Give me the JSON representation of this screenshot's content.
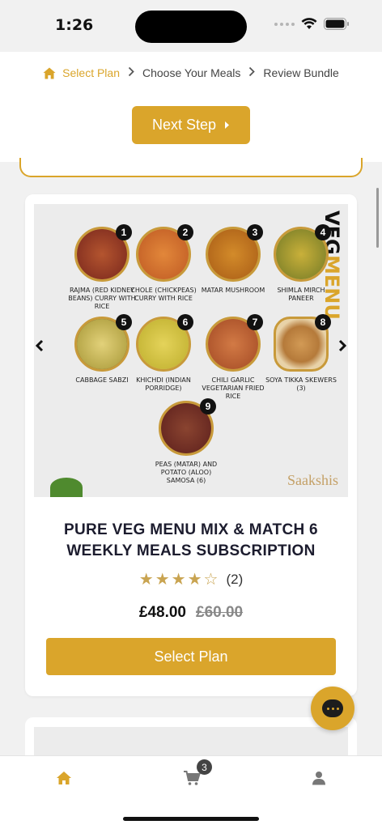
{
  "status": {
    "time": "1:26"
  },
  "breadcrumb": {
    "steps": [
      {
        "label": "Select Plan",
        "icon": "home-icon",
        "active": true
      },
      {
        "label": "Choose Your Meals",
        "active": false
      },
      {
        "label": "Review Bundle",
        "active": false
      }
    ]
  },
  "header": {
    "next_step_label": "Next Step"
  },
  "menu_image": {
    "title_line1": "VEG",
    "title_line2": "MENU",
    "brand": "Saakshis",
    "dishes": [
      {
        "num": "1",
        "name": "RAJMA (RED KIDNEY BEANS) CURRY WITH RICE",
        "color": "#a8452d"
      },
      {
        "num": "2",
        "name": "CHOLE (CHICKPEAS) CURRY WITH RICE",
        "color": "#d77a2c"
      },
      {
        "num": "3",
        "name": "MATAR MUSHROOM",
        "color": "#c2761f"
      },
      {
        "num": "4",
        "name": "SHIMLA MIRCH PANEER",
        "color": "#c8a52e"
      },
      {
        "num": "5",
        "name": "CABBAGE SABZI",
        "color": "#d9c06a"
      },
      {
        "num": "6",
        "name": "KHICHDI (INDIAN PORRIDGE)",
        "color": "#d8c84a"
      },
      {
        "num": "7",
        "name": "CHILI GARLIC VEGETARIAN FRIED RICE",
        "color": "#c46a3a"
      },
      {
        "num": "8",
        "name": "SOYA TIKKA SKEWERS (3)",
        "color": "#c98f4a"
      },
      {
        "num": "9",
        "name": "PEAS (MATAR) AND POTATO (ALOO) SAMOSA (6)",
        "color": "#7a3a2a"
      }
    ]
  },
  "product": {
    "name": "PURE VEG MENU MIX & MATCH 6 WEEKLY MEALS SUBSCRIPTION",
    "rating": 4,
    "rating_max": 5,
    "review_count": "(2)",
    "price_now": "£48.00",
    "price_old": "£60.00",
    "select_label": "Select Plan"
  },
  "tab_bar": {
    "cart_count": "3"
  },
  "colors": {
    "accent": "#daa52b",
    "text_dark": "#1c1c2e"
  }
}
